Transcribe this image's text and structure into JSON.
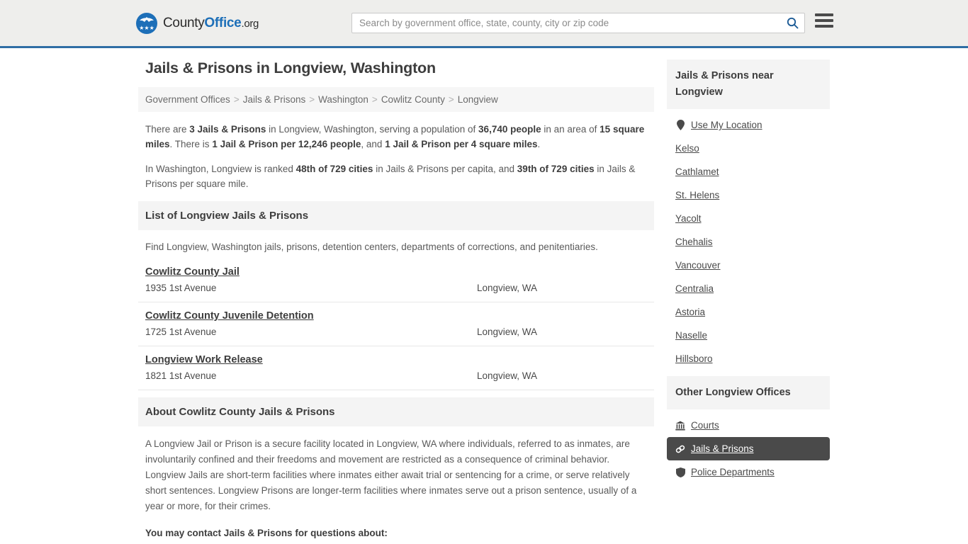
{
  "header": {
    "brand": {
      "part1": "County",
      "part2": "Office",
      "part3": ".org",
      "logo_icon": "eagle-seal-icon",
      "stars": "★★★"
    },
    "search": {
      "placeholder": "Search by government office, state, county, city or zip code",
      "value": "",
      "icon": "search-icon"
    },
    "menu_icon": "hamburger-menu-icon"
  },
  "main": {
    "title": "Jails & Prisons in Longview, Washington",
    "breadcrumb": [
      "Government Offices",
      "Jails & Prisons",
      "Washington",
      "Cowlitz County",
      "Longview"
    ],
    "breadcrumb_separator": ">",
    "intro": {
      "p1_a": "There are ",
      "p1_b1": "3 Jails & Prisons",
      "p1_b": " in Longview, Washington, serving a population of ",
      "p1_b2": "36,740 people",
      "p1_c": " in an area of ",
      "p1_b3": "15 square miles",
      "p1_d": ". There is ",
      "p1_b4": "1 Jail & Prison per 12,246 people",
      "p1_e": ", and ",
      "p1_b5": "1 Jail & Prison per 4 square miles",
      "p1_f": ".",
      "p2_a": "In Washington, Longview is ranked ",
      "p2_b1": "48th of 729 cities",
      "p2_b": " in Jails & Prisons per capita, and ",
      "p2_b2": "39th of 729 cities",
      "p2_c": " in Jails & Prisons per square mile."
    },
    "list_section": {
      "heading": "List of Longview Jails & Prisons",
      "description": "Find Longview, Washington jails, prisons, detention centers, departments of corrections, and penitentiaries.",
      "items": [
        {
          "name": "Cowlitz County Jail",
          "address": "1935 1st Avenue",
          "city": "Longview, WA"
        },
        {
          "name": "Cowlitz County Juvenile Detention",
          "address": "1725 1st Avenue",
          "city": "Longview, WA"
        },
        {
          "name": "Longview Work Release",
          "address": "1821 1st Avenue",
          "city": "Longview, WA"
        }
      ]
    },
    "about_section": {
      "heading": "About Cowlitz County Jails & Prisons",
      "paragraph": "A Longview Jail or Prison is a secure facility located in Longview, WA where individuals, referred to as inmates, are involuntarily confined and their freedoms and movement are restricted as a consequence of criminal behavior. Longview Jails are short-term facilities where inmates either await trial or sentencing for a crime, or serve relatively short sentences. Longview Prisons are longer-term facilities where inmates serve out a prison sentence, usually of a year or more, for their crimes.",
      "contact_heading": "You may contact Jails & Prisons for questions about:"
    }
  },
  "sidebar": {
    "near_panel": {
      "heading": "Jails & Prisons near Longview",
      "use_my_location": {
        "label": "Use My Location",
        "icon": "map-pin-icon"
      },
      "cities": [
        "Kelso",
        "Cathlamet",
        "St. Helens",
        "Yacolt",
        "Chehalis",
        "Vancouver",
        "Centralia",
        "Astoria",
        "Naselle",
        "Hillsboro"
      ]
    },
    "other_panel": {
      "heading": "Other Longview Offices",
      "items": [
        {
          "label": "Courts",
          "icon": "courthouse-icon",
          "active": false
        },
        {
          "label": "Jails & Prisons",
          "icon": "handcuffs-icon",
          "active": true
        },
        {
          "label": "Police Departments",
          "icon": "shield-icon",
          "active": false
        }
      ]
    }
  },
  "colors": {
    "brand_blue": "#1d6fb8",
    "header_border": "#2e6da4",
    "header_bg": "#eeeeec",
    "panel_bg": "#f4f4f4",
    "active_bg": "#4a4a4a",
    "text": "#4a4a4a"
  }
}
